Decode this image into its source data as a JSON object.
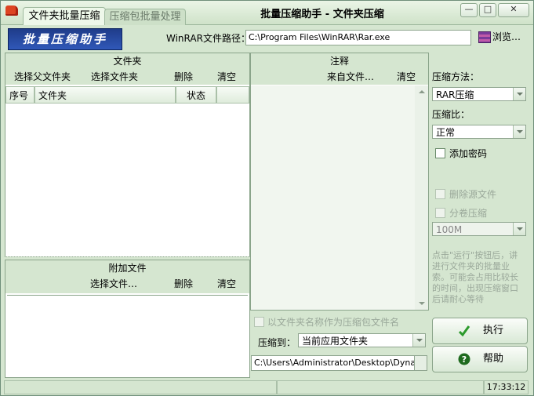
{
  "window": {
    "title": "批量压缩助手 - 文件夹压缩",
    "tabs": [
      {
        "label": "文件夹批量压缩",
        "active": true
      },
      {
        "label": "压缩包批量处理",
        "active": false
      }
    ],
    "controls": {
      "minimize": "—",
      "restore": "□",
      "close": "✕"
    }
  },
  "header": {
    "logo_text": "批量压缩助手",
    "winrar_label": "WinRAR文件路径：",
    "winrar_path": "C:\\Program Files\\WinRAR\\Rar.exe",
    "browse_label": "浏览…"
  },
  "folder_panel": {
    "title": "文件夹",
    "actions": [
      "选择父文件夹",
      "选择文件夹",
      "删除",
      "清空"
    ],
    "columns": [
      "序号",
      "文件夹",
      "状态"
    ]
  },
  "attach_panel": {
    "title": "附加文件",
    "actions": [
      "选择文件…",
      "删除",
      "清空"
    ]
  },
  "comment_panel": {
    "title": "注释",
    "actions": [
      "来自文件…",
      "清空"
    ]
  },
  "options": {
    "use_folder_name_label": "以文件夹名称作为压缩包文件名",
    "compress_to_label": "压缩到：",
    "compress_to_value": "当前应用文件夹",
    "target_path": "C:\\Users\\Administrator\\Desktop\\DynamicS"
  },
  "right": {
    "method_label": "压缩方法：",
    "method_value": "RAR压缩",
    "ratio_label": "压缩比：",
    "ratio_value": "正常",
    "add_password_label": "添加密码",
    "delete_source_label": "删除源文件",
    "split_label": "分卷压缩",
    "split_size": "100M",
    "hint": "点击\"运行\"按钮后，讲进行文件夹的批量业索。可能会占用比较长的时间，出现压缩窗口后请耐心等待",
    "run_label": "执行",
    "help_label": "帮助"
  },
  "statusbar": {
    "time": "17:33:12"
  },
  "colors": {
    "window_bg": "#d5e6d0",
    "logo_bg": "#2a4ea8",
    "run_icon": "#2c9a2c",
    "help_icon": "#1e6a1e"
  }
}
